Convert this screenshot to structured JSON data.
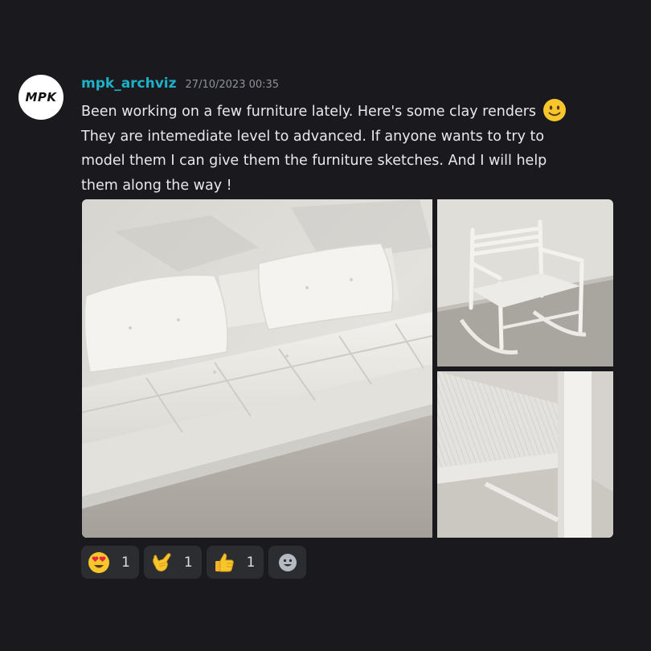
{
  "message": {
    "avatar_text": "MPK",
    "username": "mpk_archviz",
    "timestamp": "27/10/2023 00:35",
    "lines": [
      "Been working on a few furniture lately. Here's some clay renders",
      "They are intemediate level to advanced. If anyone wants to try to",
      "model them I can give them the furniture sketches. And I will help",
      "them along the way !"
    ],
    "inline_emoji": "slightly-smiling-face"
  },
  "attachments": [
    {
      "subject": "sofa-render"
    },
    {
      "subject": "rocking-chair-render"
    },
    {
      "subject": "chair-detail-render"
    }
  ],
  "reactions": [
    {
      "emoji": "heart-eyes-face",
      "count": "1"
    },
    {
      "emoji": "call-me-hand",
      "count": "1"
    },
    {
      "emoji": "thumbs-up",
      "count": "1"
    }
  ],
  "add_reaction_icon": "smiley-add-icon",
  "colors": {
    "background": "#1a1a1e",
    "username": "#1fb0c9",
    "timestamp": "#8e9297",
    "text": "#e8e9ea",
    "reaction_bg": "#2b2d31"
  }
}
